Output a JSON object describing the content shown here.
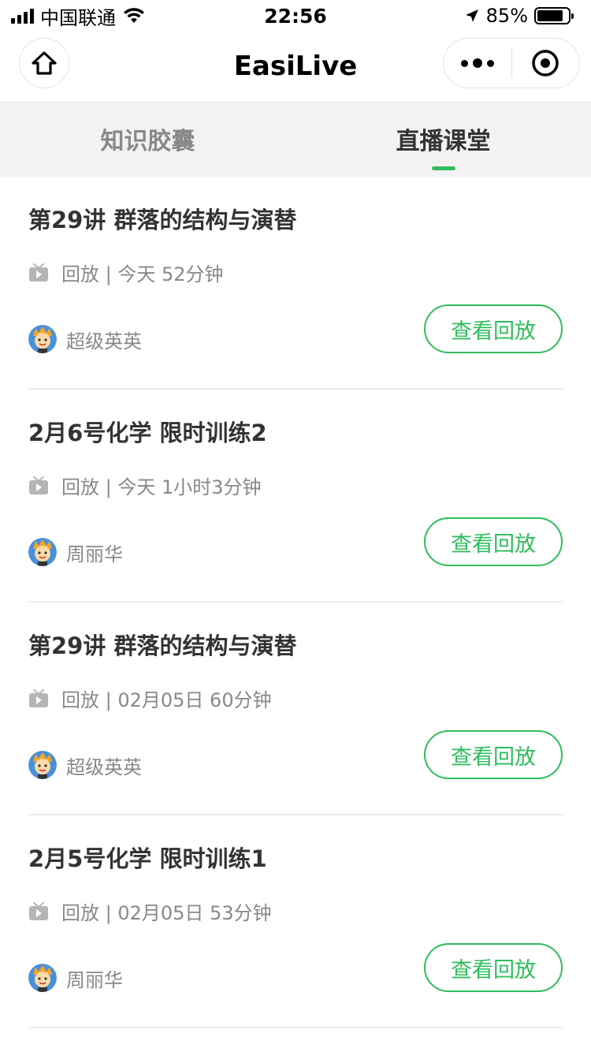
{
  "status_bar": {
    "carrier": "中国联通",
    "time": "22:56",
    "battery": "85%",
    "battery_level": 0.85
  },
  "nav": {
    "title": "EasiLive",
    "home_icon": "home-icon",
    "more_icon": "more-dots-icon",
    "close_icon": "target-circle-icon"
  },
  "tabs": [
    {
      "label": "知识胶囊",
      "active": false
    },
    {
      "label": "直播课堂",
      "active": true
    }
  ],
  "colors": {
    "accent": "#2fbd5d",
    "tab_bg": "#f2f2f2",
    "muted_text": "#888888",
    "title_text": "#333333"
  },
  "lessons": [
    {
      "title": "第29讲 群落的结构与演替",
      "meta": "回放 | 今天 52分钟",
      "author": "超级英英",
      "button": "查看回放"
    },
    {
      "title": "2月6号化学 限时训练2",
      "meta": "回放 | 今天 1小时3分钟",
      "author": "周丽华",
      "button": "查看回放"
    },
    {
      "title": "第29讲 群落的结构与演替",
      "meta": "回放 | 02月05日 60分钟",
      "author": "超级英英",
      "button": "查看回放"
    },
    {
      "title": "2月5号化学 限时训练1",
      "meta": "回放 | 02月05日 53分钟",
      "author": "周丽华",
      "button": "查看回放"
    }
  ]
}
